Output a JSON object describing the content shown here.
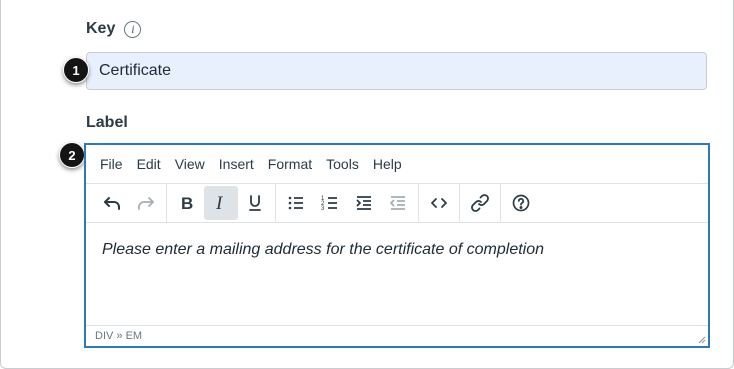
{
  "key_field": {
    "label": "Key",
    "value": "Certificate"
  },
  "badges": [
    "1",
    "2"
  ],
  "label_field": {
    "label": "Label"
  },
  "editor": {
    "menu": [
      "File",
      "Edit",
      "View",
      "Insert",
      "Format",
      "Tools",
      "Help"
    ],
    "content": "Please enter a mailing address for the certificate of completion",
    "status_path": "DIV » EM"
  },
  "colors": {
    "editor_border": "#2b7abc",
    "input_bg": "#e8f0fe",
    "badge_bg": "#141414"
  }
}
